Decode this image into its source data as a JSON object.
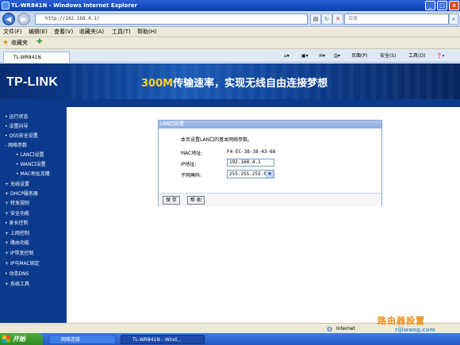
{
  "window": {
    "title": "TL-WR841N - Windows Internet Explorer"
  },
  "address": {
    "url": "http://192.168.4.1/",
    "search_placeholder": "百度"
  },
  "menu": [
    "文件(F)",
    "编辑(E)",
    "查看(V)",
    "收藏夹(A)",
    "工具(T)",
    "帮助(H)"
  ],
  "favorites": {
    "label": "收藏夹"
  },
  "tab": {
    "label": "TL-WR841N"
  },
  "tab_tools": {
    "page": "页面(P)",
    "safety": "安全(S)",
    "tools": "工具(O)"
  },
  "banner": {
    "logo": "TP-LINK",
    "slogan_accent": "300M",
    "slogan_rest": "传输速率，实现无线自由连接梦想"
  },
  "sidebar": {
    "items": [
      {
        "label": "运行状态"
      },
      {
        "label": "设置向导"
      },
      {
        "label": "QSS安全设置"
      },
      {
        "label": "网络参数"
      },
      {
        "label": "LAN口设置"
      },
      {
        "label": "WAN口设置"
      },
      {
        "label": "MAC地址克隆"
      },
      {
        "label": "无线设置"
      },
      {
        "label": "DHCP服务器"
      },
      {
        "label": "转发规则"
      },
      {
        "label": "安全功能"
      },
      {
        "label": "家长控制"
      },
      {
        "label": "上网控制"
      },
      {
        "label": "路由功能"
      },
      {
        "label": "IP带宽控制"
      },
      {
        "label": "IP与MAC绑定"
      },
      {
        "label": "动态DNS"
      },
      {
        "label": "系统工具"
      }
    ]
  },
  "lan": {
    "title": "LAN口设置",
    "description": "本页设置LAN口的基本网络参数。",
    "mac_label": "MAC地址:",
    "mac_value": "F4-EC-38-38-43-68",
    "ip_label": "IP地址:",
    "ip_value": "192.168.4.1",
    "mask_label": "子网掩码:",
    "mask_value": "255.255.255.0",
    "save_label": "保 存",
    "help_label": "帮 助"
  },
  "status": {
    "zone": "Internet"
  },
  "taskbar": {
    "start": "开始",
    "task1": "网络连接",
    "task2": "TL-WR841N - Wind..."
  },
  "watermark": {
    "line1": "路由器設置",
    "line2": "rijiwang.com"
  }
}
